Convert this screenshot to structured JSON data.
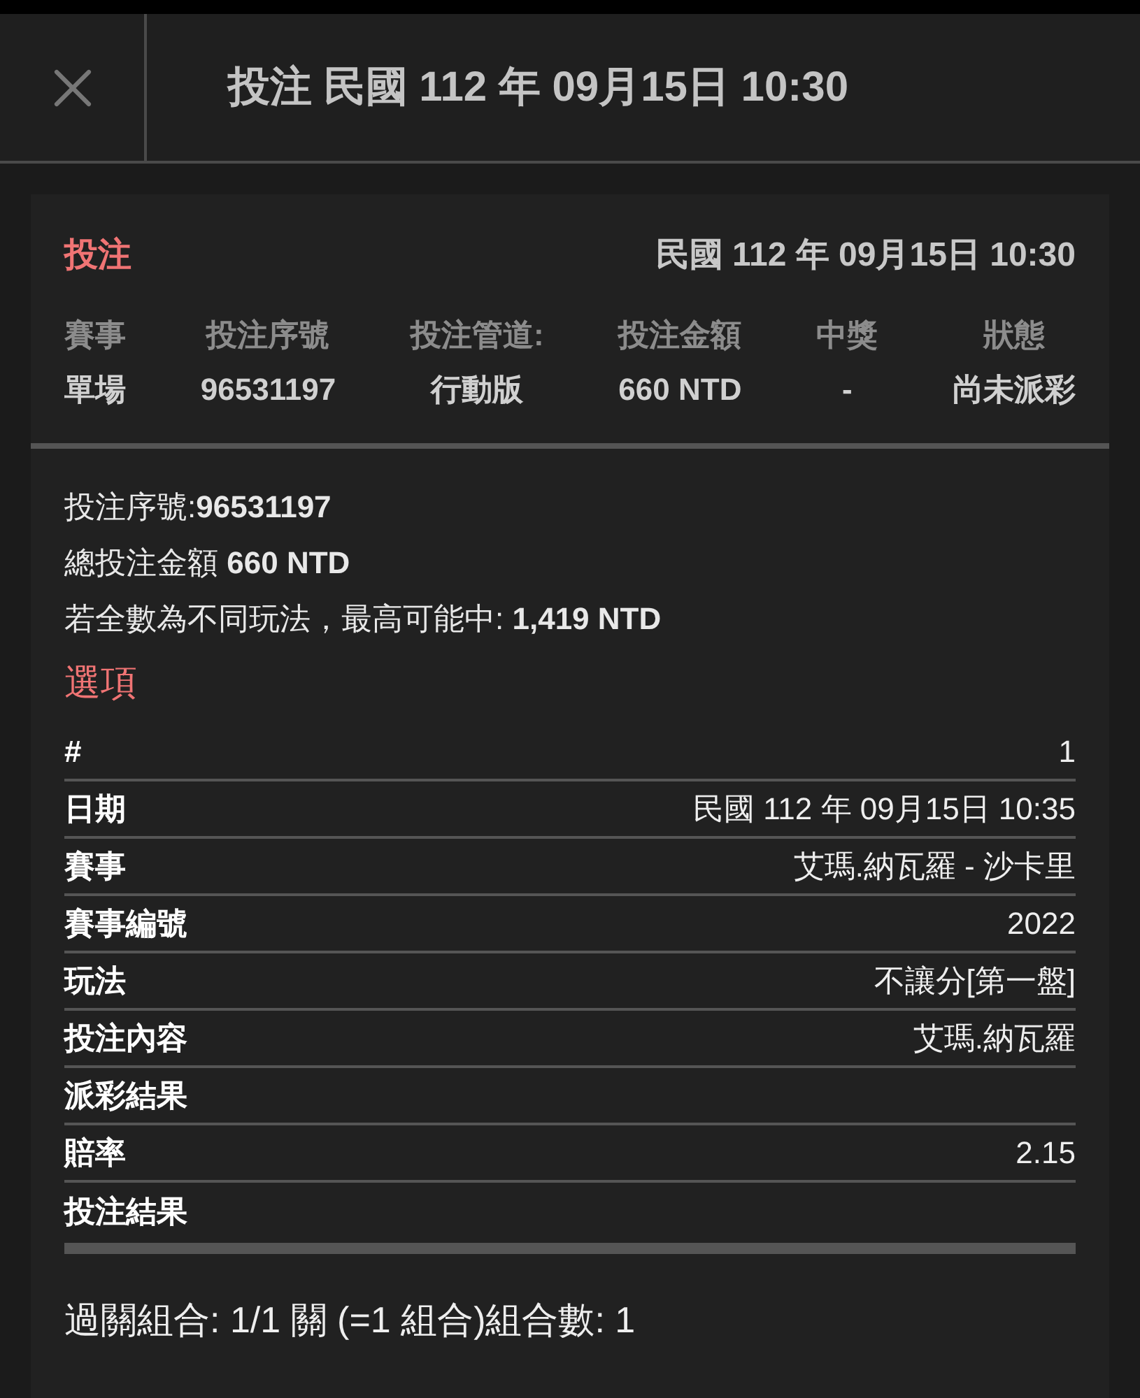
{
  "header": {
    "title": "投注 民國 112 年 09月15日 10:30"
  },
  "bet": {
    "heading": "投注",
    "datetime": "民國 112 年 09月15日 10:30",
    "summary": [
      {
        "label": "賽事",
        "value": "單場"
      },
      {
        "label": "投注序號",
        "value": "96531197"
      },
      {
        "label": "投注管道:",
        "value": "行動版"
      },
      {
        "label": "投注金額",
        "value": "660 NTD"
      },
      {
        "label": "中獎",
        "value": "-"
      },
      {
        "label": "狀態",
        "value": "尚未派彩"
      }
    ],
    "details": [
      "投注序號:**96531197**",
      "總投注金額 **660 NTD**",
      "若全數為不同玩法，最高可能中: **1,419 NTD**"
    ],
    "options_heading": "選項",
    "options": [
      {
        "label": "#",
        "value": "1"
      },
      {
        "label": "日期",
        "value": "民國 112 年 09月15日 10:35"
      },
      {
        "label": "賽事",
        "value": "艾瑪.納瓦羅 - 沙卡里"
      },
      {
        "label": "賽事編號",
        "value": "2022"
      },
      {
        "label": "玩法",
        "value": "不讓分[第一盤]"
      },
      {
        "label": "投注內容",
        "value": "艾瑪.納瓦羅"
      },
      {
        "label": "派彩結果"
      },
      {
        "label": "賠率",
        "value": "2.15"
      },
      {
        "label": "投注結果"
      }
    ],
    "combination": "過關組合: 1/1 關 (=1 組合)組合數: 1"
  }
}
